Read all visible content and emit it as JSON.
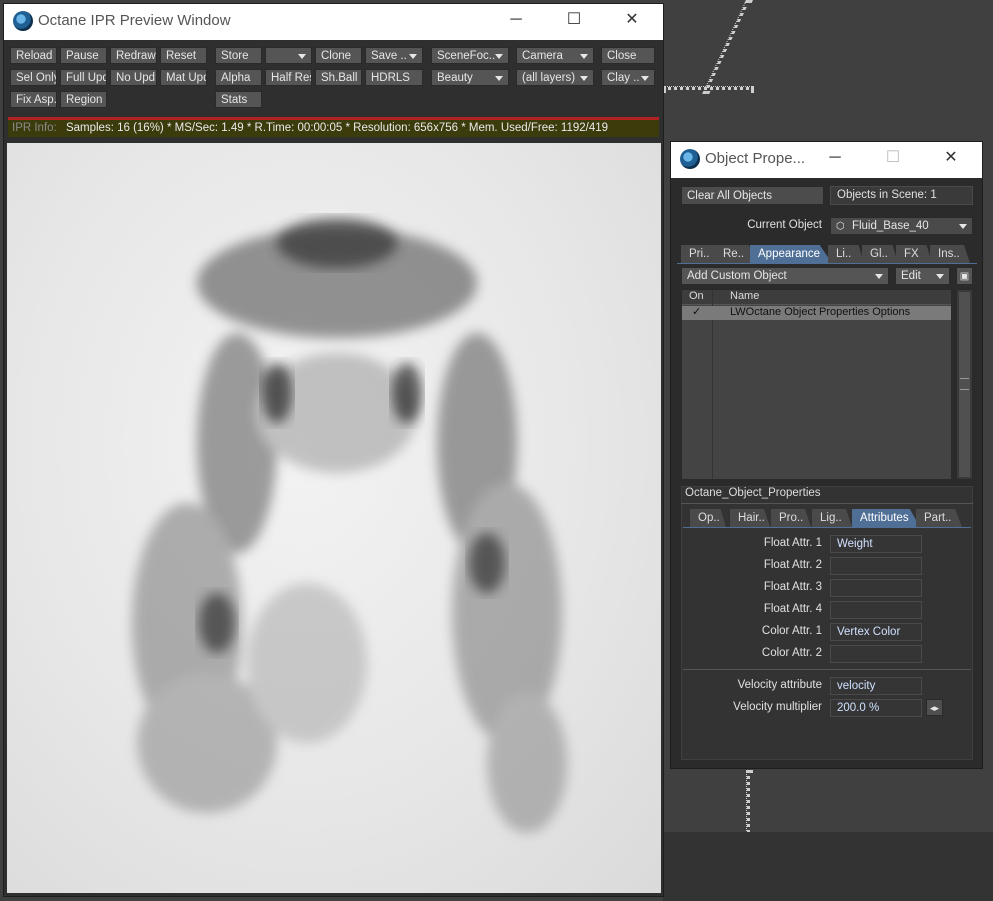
{
  "ipr": {
    "title": "Octane IPR Preview Window",
    "buttons_row1": [
      "Reload",
      "Pause",
      "Redraw",
      "Reset",
      "Store",
      "",
      "Clone",
      "Save ..",
      "SceneFoc..",
      "Camera",
      "Close"
    ],
    "buttons_row2": [
      "Sel Only",
      "Full Upd.",
      "No Upd.",
      "Mat Upd",
      "Alpha",
      "Half Res",
      "Sh.Ball",
      "HDRLS",
      "Beauty",
      "(all layers)",
      "Clay .."
    ],
    "buttons_row3": [
      "Fix Asp.",
      "Region",
      "Stats"
    ],
    "info": {
      "label": "IPR Info:",
      "text": "Samples: 16 (16%)  *  MS/Sec: 1.49  *  R.Time: 00:00:05  *  Resolution: 656x756  *  Mem. Used/Free: 1192/419"
    }
  },
  "objprops": {
    "title": "Object Prope...",
    "clear_all": "Clear All Objects",
    "objects_in_scene": "Objects in Scene: 1",
    "current_object_label": "Current Object",
    "current_object_value": "Fluid_Base_40",
    "tabs": [
      "Pri..",
      "Re..",
      "Appearance",
      "Li..",
      "Gl..",
      "FX",
      "Ins.."
    ],
    "add_custom": "Add Custom Object",
    "edit": "Edit",
    "list_headers": {
      "on": "On",
      "name": "Name"
    },
    "list_items": [
      {
        "on": "✓",
        "name": "LWOctane Object Properties Options"
      }
    ],
    "group_title": "Octane_Object_Properties",
    "subtabs": [
      "Op..",
      "Hair..",
      "Pro..",
      "Lig..",
      "Attributes",
      "Part.."
    ],
    "attrs": [
      {
        "label": "Float Attr. 1",
        "value": "Weight"
      },
      {
        "label": "Float Attr. 2",
        "value": ""
      },
      {
        "label": "Float Attr. 3",
        "value": ""
      },
      {
        "label": "Float Attr. 4",
        "value": ""
      },
      {
        "label": "Color Attr. 1",
        "value": "Vertex Color"
      },
      {
        "label": "Color Attr. 2",
        "value": ""
      }
    ],
    "velocity_attr_label": "Velocity attribute",
    "velocity_attr_value": "velocity",
    "velocity_mult_label": "Velocity multiplier",
    "velocity_mult_value": "200.0 %"
  }
}
